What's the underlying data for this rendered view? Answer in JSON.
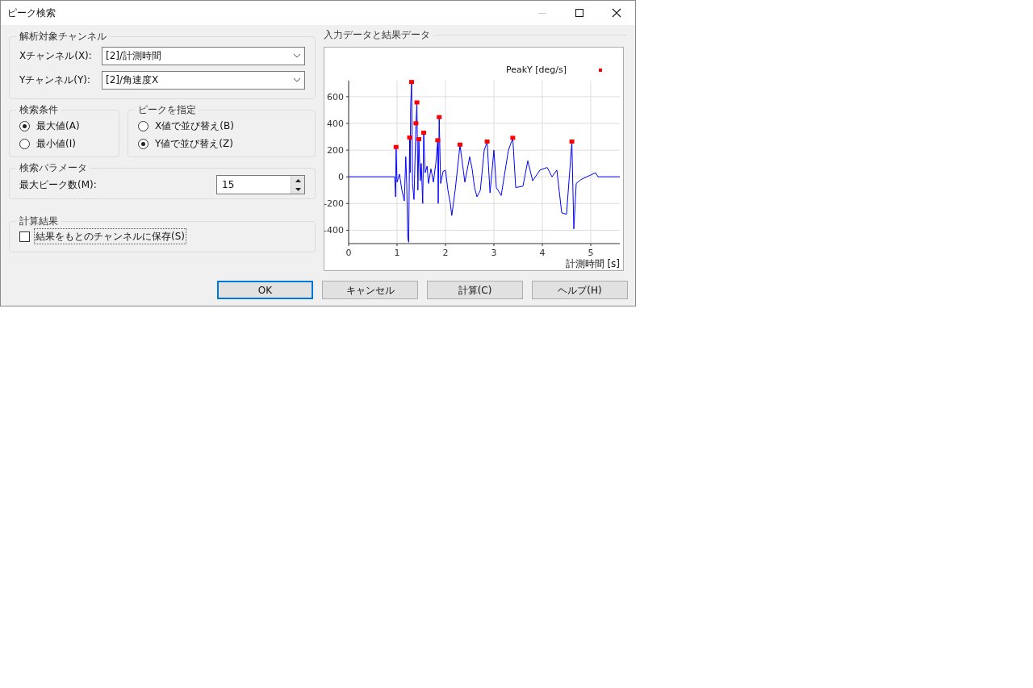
{
  "window": {
    "title": "ピーク検索"
  },
  "channel_group": {
    "title": "解析対象チャンネル",
    "fields": [
      {
        "label": "Xチャンネル(X):",
        "value": "[2]/計測時間"
      },
      {
        "label": "Yチャンネル(Y):",
        "value": "[2]/角速度X"
      }
    ]
  },
  "search_condition": {
    "title": "検索条件",
    "options": [
      {
        "label": "最大値(A)",
        "selected": true
      },
      {
        "label": "最小値(I)",
        "selected": false
      }
    ]
  },
  "peak_spec": {
    "title": "ピークを指定",
    "options": [
      {
        "label": "X値で並び替え(B)",
        "selected": false
      },
      {
        "label": "Y値で並び替え(Z)",
        "selected": true
      }
    ]
  },
  "parameters": {
    "title": "検索パラメータ",
    "label": "最大ピーク数(M):",
    "value": "15"
  },
  "result": {
    "title": "計算結果",
    "checkbox": {
      "label": "結果をもとのチャンネルに保存(S)",
      "checked": false
    }
  },
  "chart_panel": {
    "title": "入力データと結果データ",
    "chart_data": {
      "type": "scatter",
      "xlabel": "計測時間 [s]",
      "x": [
        0,
        0.95,
        0.97,
        0.98,
        1.0,
        1.05,
        1.1,
        1.15,
        1.18,
        1.2,
        1.22,
        1.24,
        1.26,
        1.27,
        1.28,
        1.3,
        1.32,
        1.35,
        1.39,
        1.41,
        1.43,
        1.45,
        1.48,
        1.5,
        1.53,
        1.55,
        1.58,
        1.62,
        1.65,
        1.7,
        1.75,
        1.8,
        1.84,
        1.85,
        1.87,
        1.9,
        1.95,
        2.0,
        2.05,
        2.1,
        2.13,
        2.2,
        2.3,
        2.4,
        2.5,
        2.55,
        2.6,
        2.65,
        2.72,
        2.8,
        2.86,
        2.92,
        3.0,
        3.05,
        3.15,
        3.3,
        3.39,
        3.45,
        3.6,
        3.7,
        3.8,
        3.95,
        4.1,
        4.2,
        4.3,
        4.4,
        4.5,
        4.61,
        4.65,
        4.7,
        4.8,
        5.1,
        5.15,
        5.6
      ],
      "series": [
        {
          "type": "line",
          "color": "#0000ff",
          "values": [
            0,
            0,
            -150,
            220,
            -40,
            20,
            -100,
            -180,
            150,
            -60,
            -450,
            -490,
            291,
            30,
            520,
            707,
            -50,
            -170,
            398,
            554,
            -100,
            279,
            -30,
            100,
            -200,
            327,
            30,
            80,
            -50,
            60,
            -40,
            100,
            271,
            -200,
            444,
            -50,
            40,
            50,
            -100,
            -200,
            -290,
            -100,
            238,
            -40,
            150,
            60,
            -80,
            -150,
            -100,
            200,
            261,
            -120,
            200,
            -80,
            -140,
            200,
            289,
            -80,
            -70,
            120,
            -30,
            50,
            70,
            0,
            50,
            -270,
            -280,
            261,
            -390,
            -50,
            -20,
            30,
            0,
            0
          ]
        },
        {
          "type": "scatter",
          "name": "PeakY [deg/s]",
          "color": "#ff0000",
          "values": [
            null,
            null,
            null,
            220,
            null,
            null,
            null,
            null,
            null,
            null,
            null,
            null,
            291,
            null,
            null,
            707,
            null,
            null,
            398,
            554,
            null,
            279,
            null,
            null,
            null,
            327,
            null,
            null,
            null,
            null,
            null,
            null,
            271,
            null,
            444,
            null,
            null,
            null,
            null,
            null,
            null,
            null,
            238,
            null,
            null,
            null,
            null,
            null,
            null,
            null,
            261,
            null,
            null,
            null,
            null,
            null,
            289,
            null,
            null,
            null,
            null,
            null,
            null,
            null,
            null,
            null,
            null,
            261,
            null,
            null,
            null,
            null,
            null,
            null
          ]
        }
      ],
      "xlim": [
        0,
        5.6
      ],
      "ylim": [
        -500,
        720
      ],
      "grid": true,
      "xticks": [
        0,
        1,
        2,
        3,
        4,
        5
      ],
      "yticks": [
        -400,
        -200,
        0,
        200,
        400,
        600
      ]
    }
  },
  "buttons": [
    {
      "label": "OK",
      "default": true
    },
    {
      "label": "キャンセル",
      "default": false
    },
    {
      "label": "計算(C)",
      "default": false
    },
    {
      "label": "ヘルプ(H)",
      "default": false
    }
  ]
}
